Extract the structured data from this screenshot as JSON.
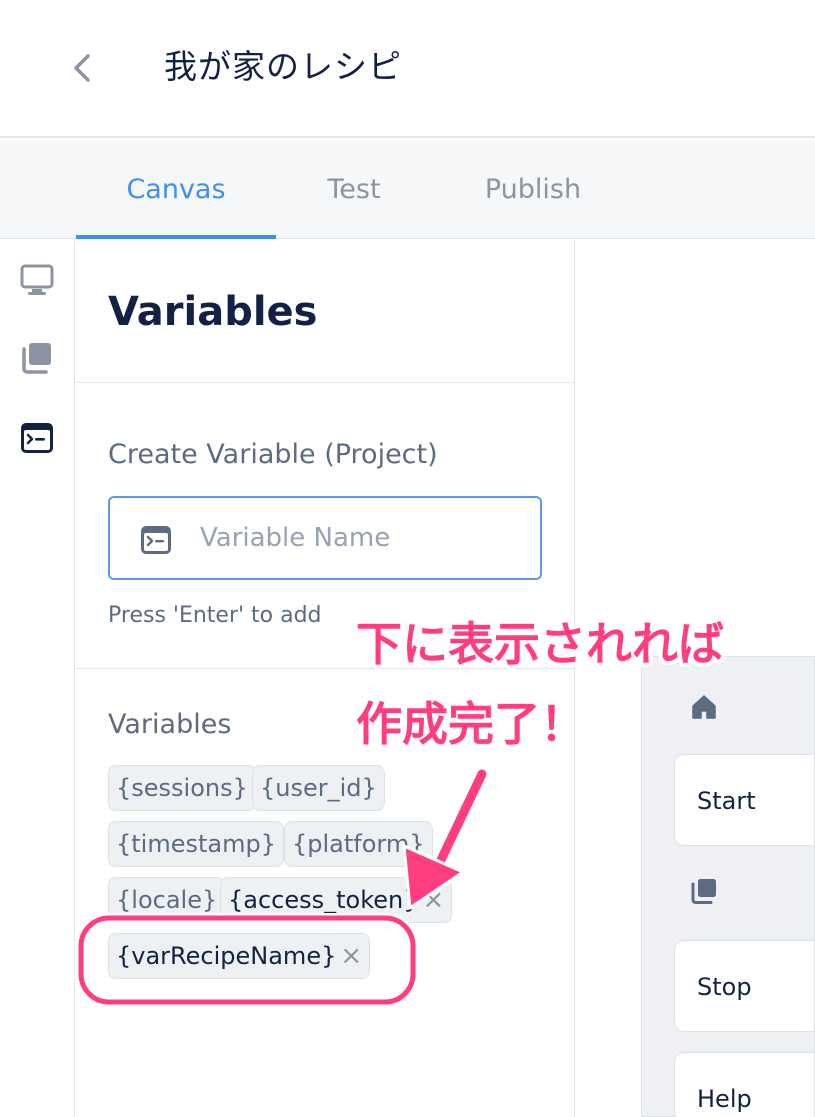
{
  "header": {
    "title": "我が家のレシピ"
  },
  "tabs": [
    {
      "label": "Canvas",
      "active": true
    },
    {
      "label": "Test",
      "active": false
    },
    {
      "label": "Publish",
      "active": false
    }
  ],
  "rail": {
    "icons": [
      "monitor-icon",
      "stack-icon",
      "variables-icon"
    ]
  },
  "panel": {
    "title": "Variables",
    "create_title": "Create Variable (Project)",
    "input_placeholder": "Variable Name",
    "input_value": "",
    "hint": "Press 'Enter' to add",
    "list_title": "Variables",
    "builtin_variables": [
      "{sessions}",
      "{user_id}",
      "{timestamp}",
      "{platform}",
      "{locale}"
    ],
    "user_variables": [
      "{access_token}",
      "{varRecipeName}"
    ],
    "remove_glyph": "×"
  },
  "blocks": {
    "cards": [
      "Start",
      "Stop",
      "Help"
    ],
    "icons": [
      "home-icon",
      "stack-icon"
    ]
  },
  "annotation": {
    "line1": "下に表示されれば",
    "line2": "作成完了！",
    "color": "#ff3d7f"
  },
  "colors": {
    "accent": "#3f8ff0",
    "text": "#132144",
    "muted": "#5d6b82",
    "annotation": "#ff3d7f"
  }
}
